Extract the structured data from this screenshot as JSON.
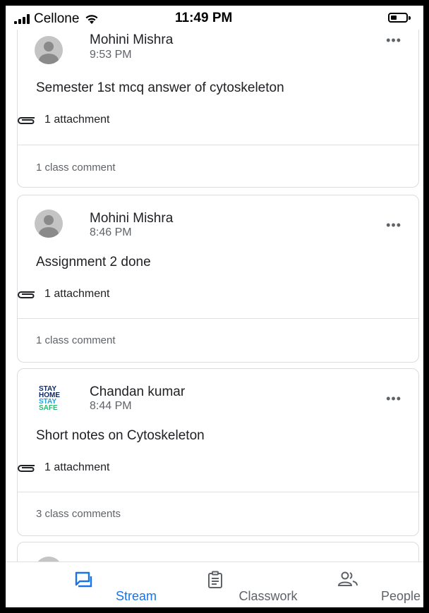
{
  "status_bar": {
    "carrier": "Cellone",
    "time": "11:49 PM"
  },
  "posts": [
    {
      "author": "Mohini Mishra",
      "time": "9:53 PM",
      "text": "Semester 1st mcq answer of cytoskeleton",
      "attachment": "1 attachment",
      "comments": "1 class comment",
      "avatar": "default-avatar"
    },
    {
      "author": "Mohini Mishra",
      "time": "8:46 PM",
      "text": "Assignment 2 done",
      "attachment": "1 attachment",
      "comments": "1 class comment",
      "avatar": "default-avatar"
    },
    {
      "author": "Chandan kumar",
      "time": "8:44 PM",
      "text": "Short notes on Cytoskeleton",
      "attachment": "1 attachment",
      "comments": "3 class comments",
      "avatar": "stay-home-logo",
      "avatar_text": [
        "STAY",
        "HOME",
        "STAY",
        "SAFE"
      ]
    }
  ],
  "bottom_nav": {
    "items": [
      {
        "label": "Stream",
        "icon": "stream-icon",
        "active": true
      },
      {
        "label": "Classwork",
        "icon": "classwork-icon",
        "active": false
      },
      {
        "label": "People",
        "icon": "people-icon",
        "active": false
      }
    ]
  },
  "colors": {
    "accent": "#1a73e8",
    "muted_text": "#5f6368",
    "border": "#dadce0"
  }
}
